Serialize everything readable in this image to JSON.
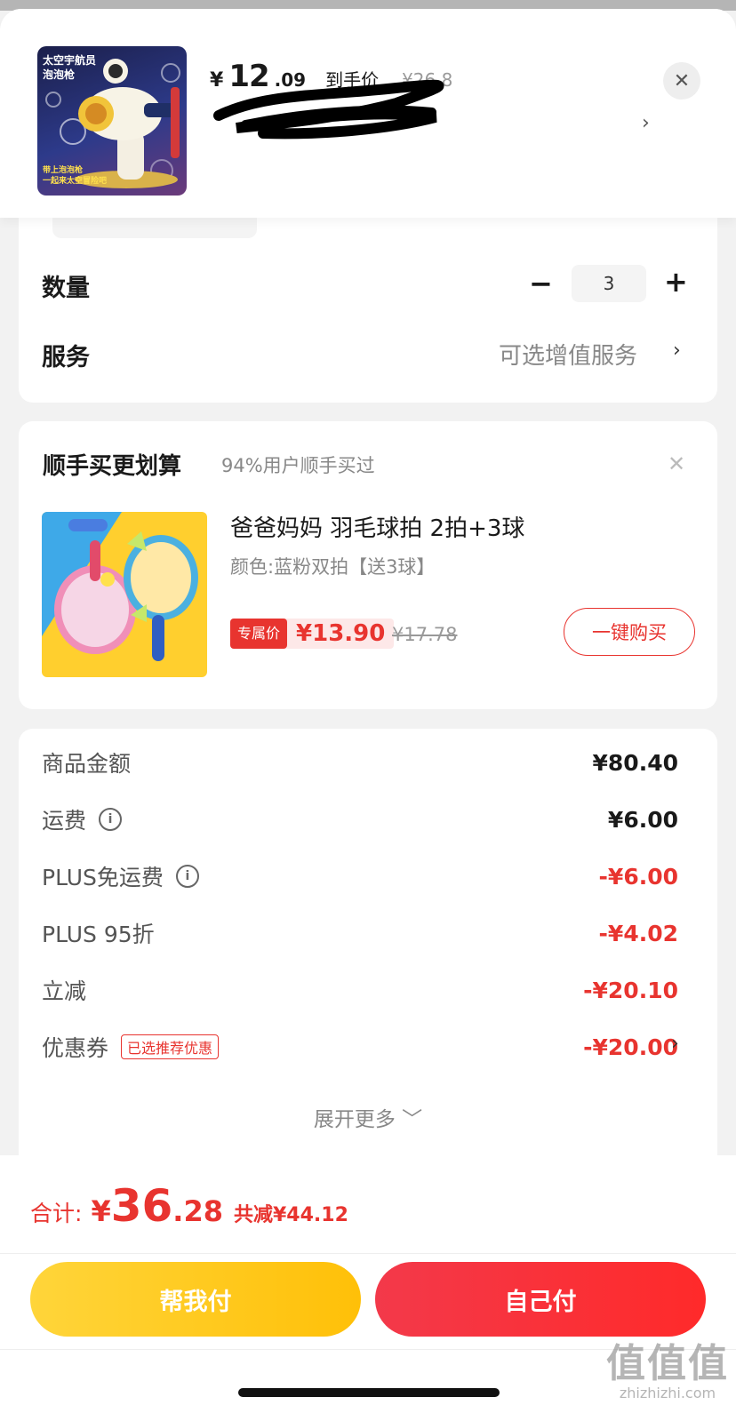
{
  "product": {
    "thumb_title": "太空宇航员\n泡泡枪",
    "thumb_caption": "带上泡泡枪\n一起来太空冒险吧",
    "price_symbol": "¥",
    "price_int": "12",
    "price_dec": ".09",
    "price_label": "到手价",
    "price_orig": "¥26.8"
  },
  "options": {
    "quantity_label": "数量",
    "quantity_value": "3",
    "minus": "−",
    "plus": "+",
    "service_label": "服务",
    "service_value": "可选增值服务"
  },
  "upsell": {
    "title": "顺手买更划算",
    "subtitle": "94%用户顺手买过",
    "item": {
      "title": "爸爸妈妈 羽毛球拍 2拍+3球",
      "spec": "颜色:蓝粉双拍【送3球】",
      "badge": "专属价",
      "price": "¥13.90",
      "orig_price": "¥17.78",
      "buy_label": "一键购买"
    }
  },
  "fees": [
    {
      "label": "商品金额",
      "value": "¥80.40",
      "red": false,
      "info": false
    },
    {
      "label": "运费",
      "value": "¥6.00",
      "red": false,
      "info": true
    },
    {
      "label": "PLUS免运费",
      "value": "-¥6.00",
      "red": true,
      "info": true
    },
    {
      "label": "PLUS 95折",
      "value": "-¥4.02",
      "red": true,
      "info": false
    },
    {
      "label": "立减",
      "value": "-¥20.10",
      "red": true,
      "info": false
    },
    {
      "label": "优惠券",
      "value": "-¥20.00",
      "red": true,
      "info": false,
      "tag": "已选推荐优惠"
    }
  ],
  "expand_label": "展开更多 ﹀",
  "total": {
    "label": "合计:",
    "symbol": "¥",
    "int": "36",
    "dec": ".28",
    "saved": "共减¥44.12"
  },
  "buttons": {
    "help_pay": "帮我付",
    "self_pay": "自己付"
  },
  "watermark": {
    "big": "值值值",
    "small": "zhizhizhi.com"
  },
  "colors": {
    "accent_red": "#e8342f",
    "help_yellow": "#ffc008",
    "self_red": "#f3394a"
  }
}
